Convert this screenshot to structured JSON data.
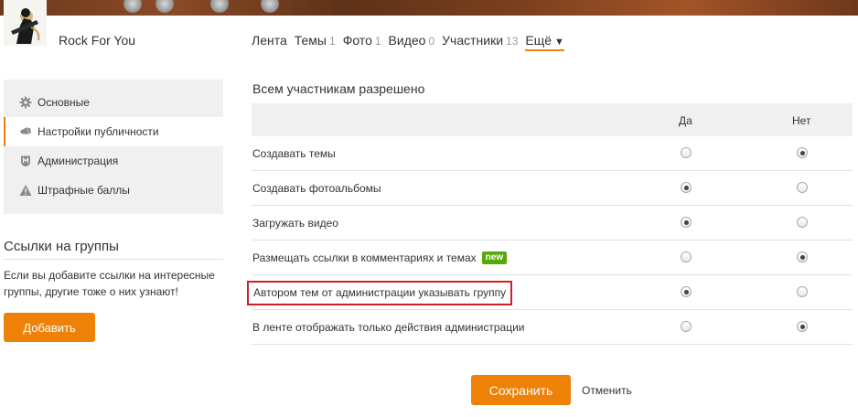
{
  "group": {
    "name": "Rock For You"
  },
  "topnav": {
    "items": [
      {
        "label": "Лента",
        "count": ""
      },
      {
        "label": "Темы",
        "count": "1"
      },
      {
        "label": "Фото",
        "count": "1"
      },
      {
        "label": "Видео",
        "count": "0"
      },
      {
        "label": "Участники",
        "count": "13"
      }
    ],
    "more_label": "Ещё",
    "more_arrow": "▼"
  },
  "left_menu": {
    "items": [
      {
        "label": "Основные",
        "icon": "gear-icon"
      },
      {
        "label": "Настройки публичности",
        "icon": "megaphone-icon"
      },
      {
        "label": "Администрация",
        "icon": "shield-m-icon"
      },
      {
        "label": "Штрафные баллы",
        "icon": "warning-icon"
      }
    ],
    "active_index": 1
  },
  "links": {
    "title": "Ссылки на группы",
    "text": "Если вы добавите ссылки на интересные группы, другие тоже о них узнают!",
    "add_label": "Добавить"
  },
  "permissions": {
    "title": "Всем участникам разрешено",
    "col_yes": "Да",
    "col_no": "Нет",
    "rows": [
      {
        "label": "Создавать темы",
        "value": "no",
        "badge": ""
      },
      {
        "label": "Создавать фотоальбомы",
        "value": "yes",
        "badge": ""
      },
      {
        "label": "Загружать видео",
        "value": "yes",
        "badge": ""
      },
      {
        "label": "Размещать ссылки в комментариях и темах",
        "value": "no",
        "badge": "new"
      },
      {
        "label": "Автором тем от администрации указывать группу",
        "value": "yes",
        "badge": ""
      },
      {
        "label": "В ленте отображать только действия администрации",
        "value": "no",
        "badge": ""
      }
    ]
  },
  "footer": {
    "save_label": "Сохранить",
    "cancel_label": "Отменить"
  },
  "colors": {
    "accent": "#ee8208",
    "highlight_border": "#d01d2a",
    "new_badge": "#59a80a"
  }
}
